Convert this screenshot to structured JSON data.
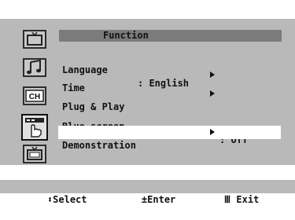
{
  "menu": {
    "title": "Function",
    "items": [
      {
        "label": "Language",
        "value": ": English",
        "has_arrow": false
      },
      {
        "label": "Time",
        "value": "",
        "has_arrow": true
      },
      {
        "label": "Plug & Play",
        "value": "",
        "has_arrow": true
      },
      {
        "label": "Blue screen",
        "value": ": Off",
        "has_arrow": false
      },
      {
        "label": "Demonstration",
        "value": "",
        "has_arrow": true,
        "selected": true
      }
    ]
  },
  "sidebar": {
    "icons": [
      "tv-picture-icon",
      "music-note-icon",
      "channel-icon",
      "function-hand-icon",
      "tv-input-icon"
    ],
    "ch_label": "CH"
  },
  "status": {
    "select_label": "Select",
    "enter_label": "Enter",
    "exit_label": "Exit"
  }
}
